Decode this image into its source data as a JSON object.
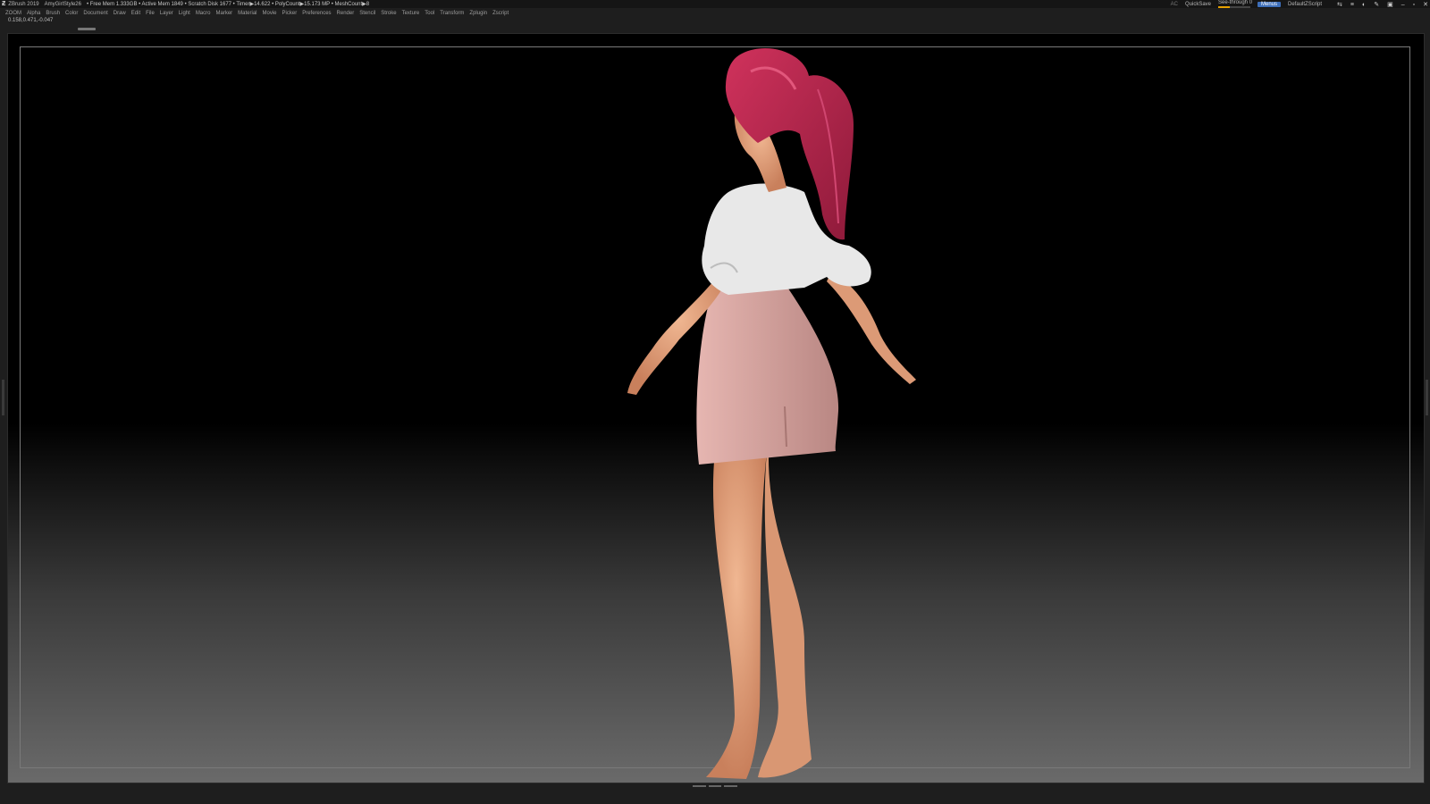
{
  "titlebar": {
    "app": "ZBrush 2019",
    "project": "AmyGirlStyle26",
    "stats": "• Free Mem 1.333GB • Active Mem 1849 • Scratch Disk 1677 • Timer▶14.622 • PolyCount▶15.173 MP • MeshCount▶8",
    "ac": "AC",
    "quicksave": "QuickSave",
    "see_through_label": "See-through",
    "see_through_value": "0",
    "see_through_level": 0.35,
    "menus": "Menus",
    "script": "DefaultZScript"
  },
  "menubar": [
    "ZOOM",
    "Alpha",
    "Brush",
    "Color",
    "Document",
    "Draw",
    "Edit",
    "File",
    "Layer",
    "Light",
    "Macro",
    "Marker",
    "Material",
    "Movie",
    "Picker",
    "Preferences",
    "Render",
    "Stencil",
    "Stroke",
    "Texture",
    "Tool",
    "Transform",
    "Zplugin",
    "Zscript"
  ],
  "coords": "0.158,0.471,-0.047",
  "icons": [
    "logo-icon",
    "help-icon",
    "layout-icon",
    "palette-icon",
    "brush-icon",
    "lock-icon",
    "minimize-icon",
    "restore-icon",
    "close-icon"
  ],
  "colors": {
    "hair": "#b8244a",
    "skin": "#e8a57e",
    "blouse": "#e9e9e9",
    "skirt": "#d7a3a0",
    "accent": "#3d6eb8"
  }
}
